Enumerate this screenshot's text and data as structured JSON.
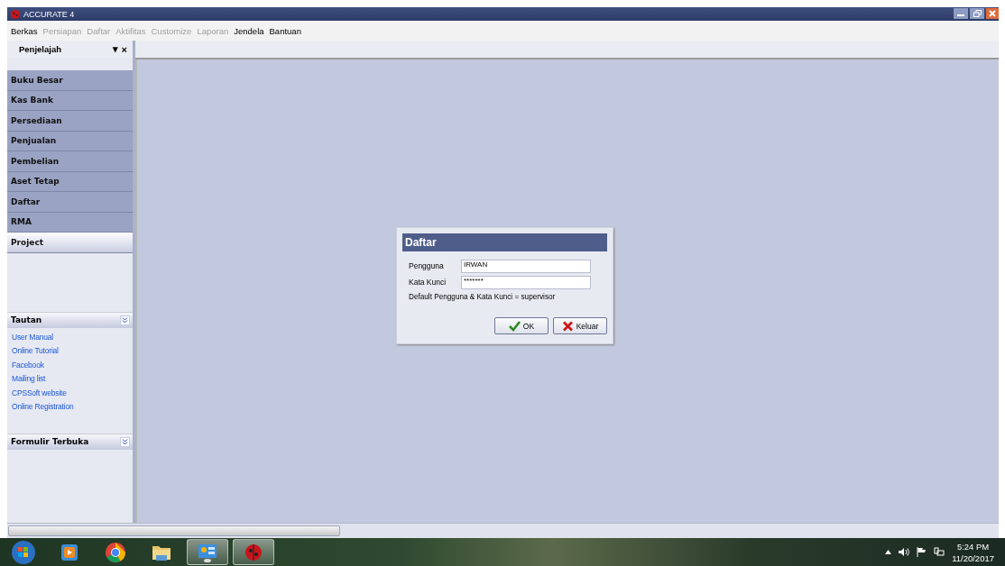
{
  "window": {
    "title": "ACCURATE 4"
  },
  "menu": [
    {
      "label": "Berkas",
      "disabled": false
    },
    {
      "label": "Persiapan",
      "disabled": true
    },
    {
      "label": "Daftar",
      "disabled": true
    },
    {
      "label": "Aktifitas",
      "disabled": true
    },
    {
      "label": "Customize",
      "disabled": true
    },
    {
      "label": "Laporan",
      "disabled": true
    },
    {
      "label": "Jendela",
      "disabled": false
    },
    {
      "label": "Bantuan",
      "disabled": false
    }
  ],
  "explorer": {
    "title": "Penjelajah",
    "pin_glyph": "▾",
    "close_glyph": "×",
    "items": [
      {
        "label": "Buku Besar",
        "selected": false
      },
      {
        "label": "Kas Bank",
        "selected": false
      },
      {
        "label": "Persediaan",
        "selected": false
      },
      {
        "label": "Penjualan",
        "selected": false
      },
      {
        "label": "Pembelian",
        "selected": false
      },
      {
        "label": "Aset Tetap",
        "selected": false
      },
      {
        "label": "Daftar",
        "selected": false
      },
      {
        "label": "RMA",
        "selected": false
      },
      {
        "label": "Project",
        "selected": true
      }
    ]
  },
  "links_panel": {
    "title": "Tautan",
    "links": [
      "User Manual",
      "Online Tutorial",
      "Facebook",
      "Mailing list",
      "CPSSoft website",
      "Online Registration"
    ]
  },
  "open_forms_panel": {
    "title": "Formulir Terbuka"
  },
  "dialog": {
    "title": "Daftar",
    "fields": [
      {
        "label": "Pengguna",
        "value": "IRWAN"
      },
      {
        "label": "Kata Kunci",
        "value": "*******"
      }
    ],
    "note": "Default Pengguna & Kata Kunci = supervisor",
    "buttons": [
      {
        "kind": "ok",
        "label": "OK"
      },
      {
        "kind": "cancel",
        "label": "Keluar"
      }
    ]
  },
  "taskbar": {
    "apps": [
      {
        "kind": "media",
        "active": false
      },
      {
        "kind": "browser",
        "active": false
      },
      {
        "kind": "folder",
        "active": false
      },
      {
        "kind": "panel",
        "active": true
      },
      {
        "kind": "accurate",
        "active": true
      }
    ],
    "time": "5:24 PM",
    "date": "11/20/2017"
  }
}
